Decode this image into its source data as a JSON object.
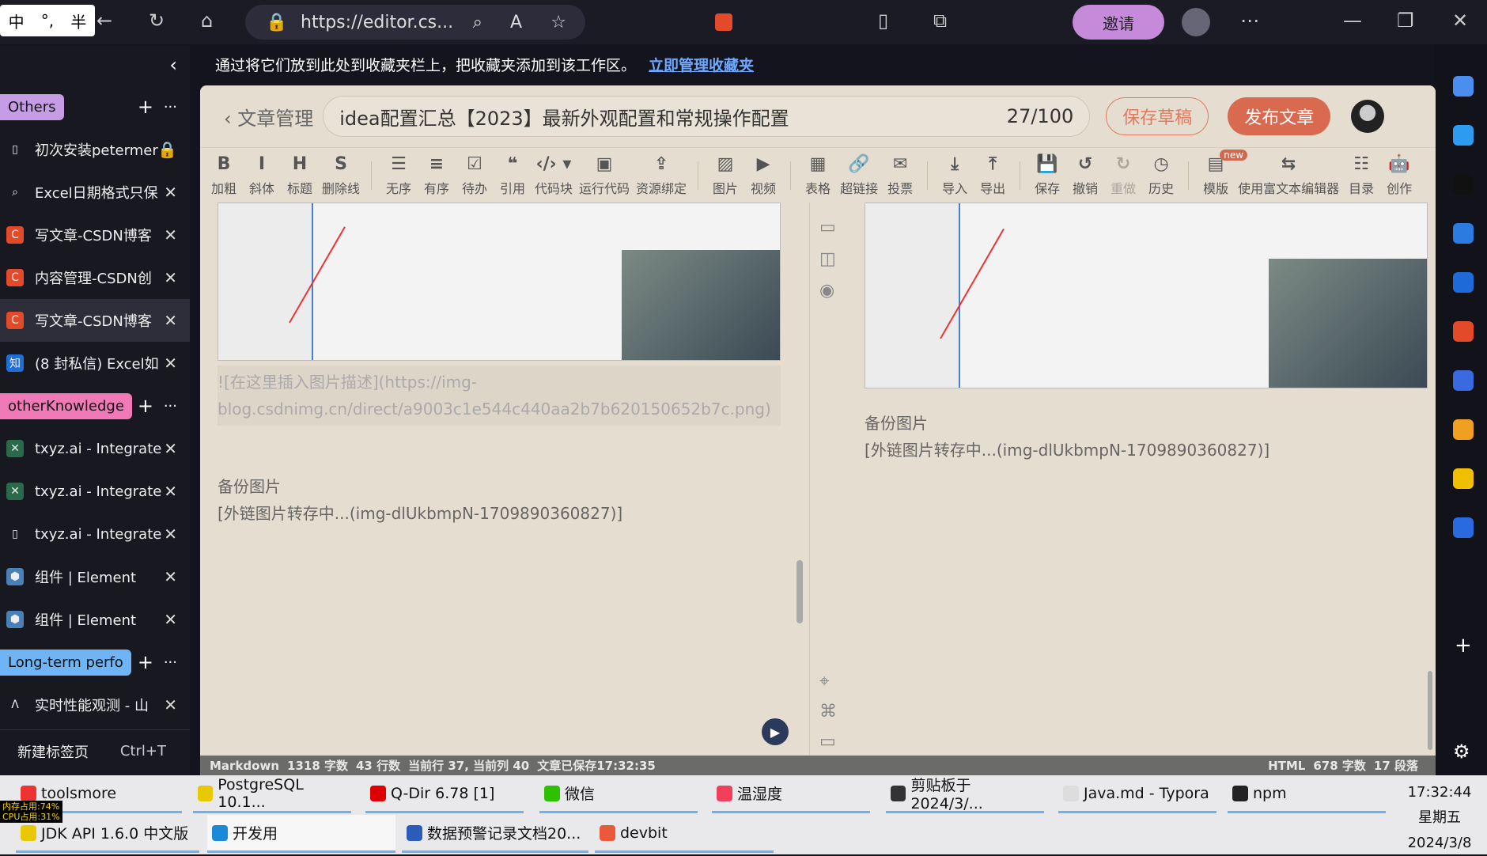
{
  "browser": {
    "ime": [
      "中",
      "°,",
      "半"
    ],
    "url": "https://editor.cs...",
    "invite": "邀请"
  },
  "favbar": {
    "text": "通过将它们放到此处到收藏夹栏上，把收藏夹添加到该工作区。",
    "link": "立即管理收藏夹"
  },
  "sidebar": {
    "groups": [
      {
        "name": "Others",
        "color": "#c79ce6",
        "tabs": [
          {
            "title": "初次安装petermer",
            "icon": "page-icon"
          },
          {
            "title": "Excel日期格式只保",
            "icon": "search-icon"
          },
          {
            "title": "写文章-CSDN博客",
            "icon": "csdn-icon"
          },
          {
            "title": "内容管理-CSDN创",
            "icon": "csdn-icon"
          },
          {
            "title": "写文章-CSDN博客",
            "icon": "csdn-icon",
            "active": true
          },
          {
            "title": "(8 封私信) Excel如",
            "icon": "zhihu-icon"
          }
        ]
      },
      {
        "name": "otherKnowledge",
        "color": "#f07ab8",
        "tabs": [
          {
            "title": "txyz.ai - Integrate",
            "icon": "txyz-icon"
          },
          {
            "title": "txyz.ai - Integrate",
            "icon": "txyz-icon"
          },
          {
            "title": "txyz.ai - Integrate",
            "icon": "page-icon"
          },
          {
            "title": "组件 | Element",
            "icon": "element-icon"
          },
          {
            "title": "组件 | Element",
            "icon": "element-icon"
          }
        ]
      },
      {
        "name": "Long-term perfo",
        "color": "#6fb4f5",
        "tabs": [
          {
            "title": "实时性能观测 - 山",
            "icon": "arms-icon"
          }
        ]
      }
    ],
    "new_tab": "新建标签页",
    "new_tab_shortcut": "Ctrl+T"
  },
  "editor": {
    "back": "文章管理",
    "title": "idea配置汇总【2023】最新外观配置和常规操作配置",
    "count": "27/100",
    "save_draft": "保存草稿",
    "publish": "发布文章",
    "toolbar": [
      [
        "B",
        "加粗"
      ],
      [
        "I",
        "斜体"
      ],
      [
        "H",
        "标题"
      ],
      [
        "S",
        "删除线"
      ],
      "|",
      [
        "☰",
        "无序"
      ],
      [
        "≡",
        "有序"
      ],
      [
        "☑",
        "待办"
      ],
      [
        "❝",
        "引用"
      ],
      [
        "‹/› ▾",
        "代码块"
      ],
      [
        "▣",
        "运行代码"
      ],
      [
        "⇪",
        "资源绑定"
      ],
      "|",
      [
        "▨",
        "图片"
      ],
      [
        "▶",
        "视频"
      ],
      "|",
      [
        "▦",
        "表格"
      ],
      [
        "🔗",
        "超链接"
      ],
      [
        "✉",
        "投票"
      ],
      "|",
      [
        "⤓",
        "导入"
      ],
      [
        "⤒",
        "导出"
      ],
      "|",
      [
        "💾",
        "保存"
      ],
      [
        "↺",
        "撤销"
      ],
      [
        "↻",
        "重做"
      ],
      [
        "◷",
        "历史"
      ],
      "|",
      [
        "▤",
        "模版"
      ],
      [
        "⇆",
        "使用富文本编辑器"
      ],
      [
        "☷",
        "目录"
      ],
      [
        "🤖",
        "创作"
      ]
    ],
    "new_badge": "new",
    "left_text": {
      "img_md": "![在这里插入图片描述](https://img-blog.csdnimg.cn/direct/a9003c1e544c440aa2b7b620150652b7c.png)",
      "backup": "备份图片",
      "pending": "[外链图片转存中...(img-dlUkbmpN-1709890360827)]"
    },
    "right_text": {
      "backup": "备份图片",
      "pending": "[外链图片转存中...(img-dlUkbmpN-1709890360827)]"
    },
    "status": {
      "left": [
        "Markdown",
        "1318 字数",
        "43 行数",
        "当前行 37, 当前列 40",
        "文章已保存17:32:35"
      ],
      "right": [
        "HTML",
        "678 字数",
        "17 段落"
      ]
    }
  },
  "taskbar": {
    "row1": [
      {
        "label": "toolsmore",
        "color": "#e33"
      },
      {
        "label": "PostgreSQL 10.1...",
        "color": "#e8c800"
      },
      {
        "label": "Q-Dir 6.78 [1]",
        "color": "#d00"
      },
      {
        "label": "微信",
        "color": "#2dc100"
      },
      {
        "label": "温湿度",
        "color": "#f0405a"
      },
      {
        "label": "剪贴板于 2024/3/...",
        "color": "#333"
      },
      {
        "label": "Java.md - Typora",
        "color": "#ddd"
      },
      {
        "label": "npm",
        "color": "#222"
      }
    ],
    "row2": [
      {
        "label": "JDK API 1.6.0 中文版",
        "color": "#e8c800"
      },
      {
        "label": "开发用",
        "color": "#1a8ad8"
      },
      {
        "label": "数据预警记录文档20...",
        "color": "#2b5cb8"
      },
      {
        "label": "devbit",
        "color": "#e85a3a"
      }
    ],
    "time": "17:32:44",
    "weekday": "星期五",
    "date": "2024/3/8",
    "perf": [
      "内存占用:74%",
      "CPU占用:31%"
    ]
  }
}
